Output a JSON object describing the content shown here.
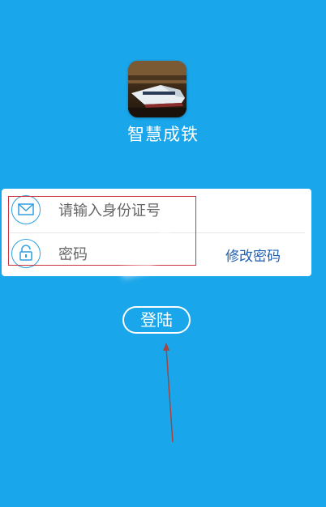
{
  "app": {
    "title": "智慧成铁",
    "logo_icon": "train-logo-icon"
  },
  "login_form": {
    "id_field": {
      "placeholder": "请输入身份证号",
      "value": "",
      "icon": "envelope-icon"
    },
    "password_field": {
      "placeholder": "密码",
      "value": "",
      "icon": "lock-icon"
    },
    "change_password_label": "修改密码"
  },
  "actions": {
    "login_label": "登陆"
  },
  "colors": {
    "background": "#1aa6ea",
    "icon_accent": "#2f9fe0",
    "link": "#1f5fb4",
    "highlight": "#cc3340"
  }
}
